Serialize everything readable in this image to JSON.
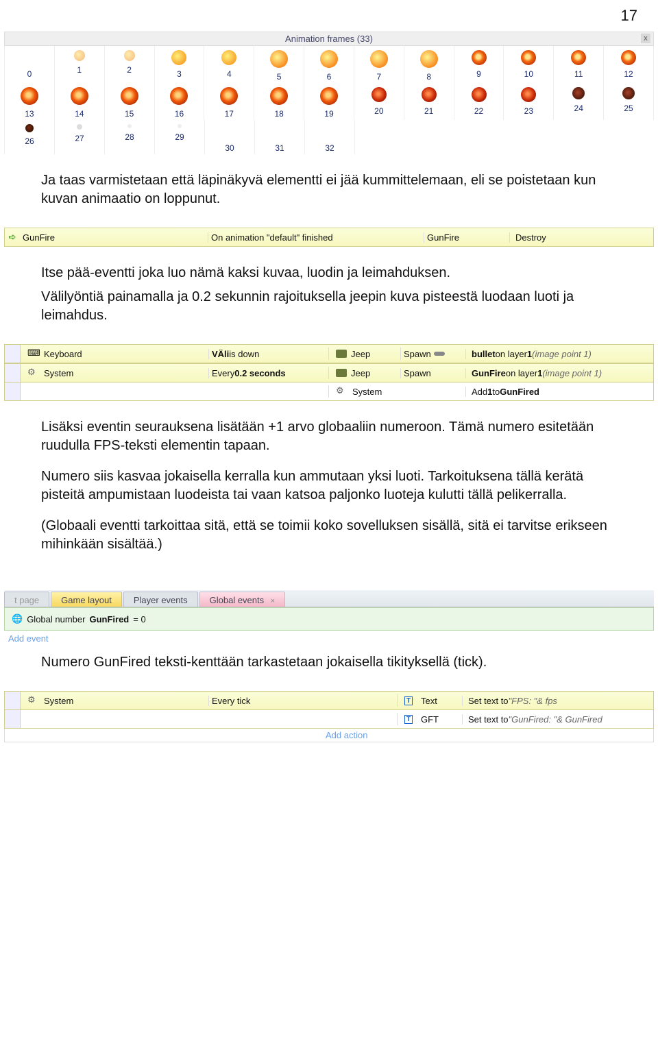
{
  "page_number": "17",
  "anim": {
    "title": "Animation frames (33)",
    "close": "x",
    "rows": [
      {
        "frames": [
          "0",
          "1",
          "2",
          "3",
          "4",
          "5",
          "6",
          "7",
          "8",
          "9",
          "10",
          "11",
          "12"
        ],
        "sprites": [
          "s-empty",
          "s-yellow-dim",
          "s-yellow-dim",
          "s-yellow",
          "s-yellow",
          "s-yellow-big",
          "s-yellow-big",
          "s-yellow-big",
          "s-yellow-big",
          "s-orange-ring",
          "s-orange-ring",
          "s-orange-ring",
          "s-orange-ring"
        ]
      },
      {
        "frames": [
          "13",
          "14",
          "15",
          "16",
          "17",
          "18",
          "19",
          "20",
          "21",
          "22",
          "23",
          "24",
          "25"
        ],
        "sprites": [
          "s-orange-big",
          "s-orange-big",
          "s-orange-big",
          "s-orange-big",
          "s-orange-big",
          "s-orange-big",
          "s-orange-big",
          "s-red",
          "s-red",
          "s-red",
          "s-red",
          "s-dark",
          "s-dark"
        ]
      },
      {
        "frames": [
          "26",
          "27",
          "28",
          "29",
          "30",
          "31",
          "32"
        ],
        "sprites": [
          "s-ember",
          "s-dust",
          "s-dust2",
          "s-dust2",
          "s-empty",
          "s-empty",
          "s-empty"
        ]
      }
    ]
  },
  "para1": "Ja taas varmistetaan että läpinäkyvä elementti ei jää kummittelemaan, eli se poistetaan kun kuvan animaatio on loppunut.",
  "event1": {
    "gutter_arrow": "➪",
    "cond_obj": "GunFire",
    "cond_text": "On animation \"default\" finished",
    "act_obj": "GunFire",
    "act_text": "Destroy"
  },
  "para2a": "Itse pää-eventti joka luo nämä kaksi kuvaa, luodin ja leimahduksen.",
  "para2b": "Välilyöntiä painamalla ja 0.2 sekunnin rajoituksella jeepin kuva pisteestä luodaan luoti ja leimahdus.",
  "event2": {
    "r1": {
      "cond_obj": "Keyboard",
      "cond_key": "VÄli",
      "cond_rest": " is down",
      "act_obj": "Jeep",
      "act_verb": "Spawn",
      "act_bullet": "bullet",
      "act_rest": " on layer ",
      "act_layer": "1",
      "act_tail": " (image point 1)"
    },
    "r2": {
      "cond_obj": "System",
      "cond_text": "Every ",
      "cond_bold": "0.2 seconds",
      "act_obj": "Jeep",
      "act_verb": "Spawn",
      "act_bullet": "GunFire",
      "act_rest": " on layer ",
      "act_layer": "1",
      "act_tail": " (image point 1)"
    },
    "r3": {
      "act_obj": "System",
      "act_text_pre": "Add ",
      "act_num": "1",
      "act_text_mid": " to ",
      "act_bold": "GunFired"
    }
  },
  "para3a": "Lisäksi eventin seurauksena lisätään +1 arvo globaaliin numeroon. Tämä numero esitetään ruudulla FPS-teksti elementin tapaan.",
  "para3b": "Numero siis kasvaa jokaisella kerralla kun ammutaan yksi luoti. Tarkoituksena tällä kerätä pisteitä ampumistaan luodeista tai vaan katsoa paljonko luoteja kulutti tällä pelikerralla.",
  "para3c": "(Globaali eventti tarkoittaa sitä, että se toimii koko sovelluksen sisällä, sitä ei tarvitse erikseen mihinkään sisältää.)",
  "tabs": {
    "t1": "t page",
    "t2": "Game layout",
    "t3": "Player events",
    "t4": "Global events",
    "x": "×"
  },
  "global_line_pre": "Global number ",
  "global_var": "GunFired",
  "global_line_post": " = 0",
  "add_event": "Add event",
  "para4": "Numero GunFired teksti-kenttään tarkastetaan jokaisella tikityksellä (tick).",
  "event3": {
    "cond_obj": "System",
    "cond_text": "Every tick",
    "a1": {
      "obj": "Text",
      "text": "Set text to ",
      "q": "\"FPS: \"",
      "amp": " & fps"
    },
    "a2": {
      "obj": "GFT",
      "text": "Set text to ",
      "q": "\"GunFired: \"",
      "amp": " & GunFired"
    },
    "add": "Add action"
  }
}
